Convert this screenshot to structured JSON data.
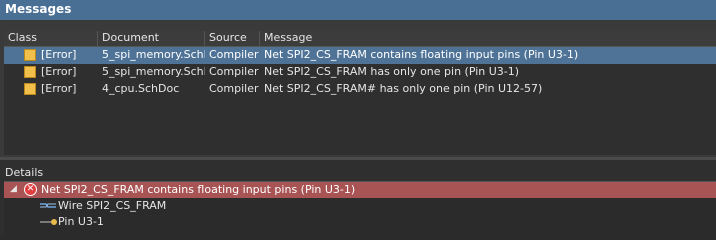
{
  "panel": {
    "title": "Messages"
  },
  "table": {
    "headers": {
      "class": "Class",
      "document": "Document",
      "source": "Source",
      "message": "Message"
    },
    "rows": [
      {
        "class": "[Error]",
        "document": "5_spi_memory.SchDoc",
        "source": "Compiler",
        "message": "Net SPI2_CS_FRAM contains floating input pins (Pin U3-1)",
        "selected": true
      },
      {
        "class": "[Error]",
        "document": "5_spi_memory.SchDoc",
        "source": "Compiler",
        "message": "Net SPI2_CS_FRAM has only one pin (Pin U3-1)",
        "selected": false
      },
      {
        "class": "[Error]",
        "document": "4_cpu.SchDoc",
        "source": "Compiler",
        "message": "Net SPI2_CS_FRAM# has only one pin (Pin U12-57)",
        "selected": false
      }
    ]
  },
  "details": {
    "label": "Details",
    "items": [
      {
        "text": "Net SPI2_CS_FRAM contains floating input pins (Pin U3-1)",
        "icon": "error-circle-icon"
      },
      {
        "text": "Wire SPI2_CS_FRAM",
        "icon": "wire-icon"
      },
      {
        "text": "Pin U3-1",
        "icon": "pin-icon"
      }
    ]
  },
  "colors": {
    "title_bar": "#4a6f94",
    "selected_row": "#4f7397",
    "error_detail": "#a85454",
    "error_icon": "#f2c04a"
  }
}
